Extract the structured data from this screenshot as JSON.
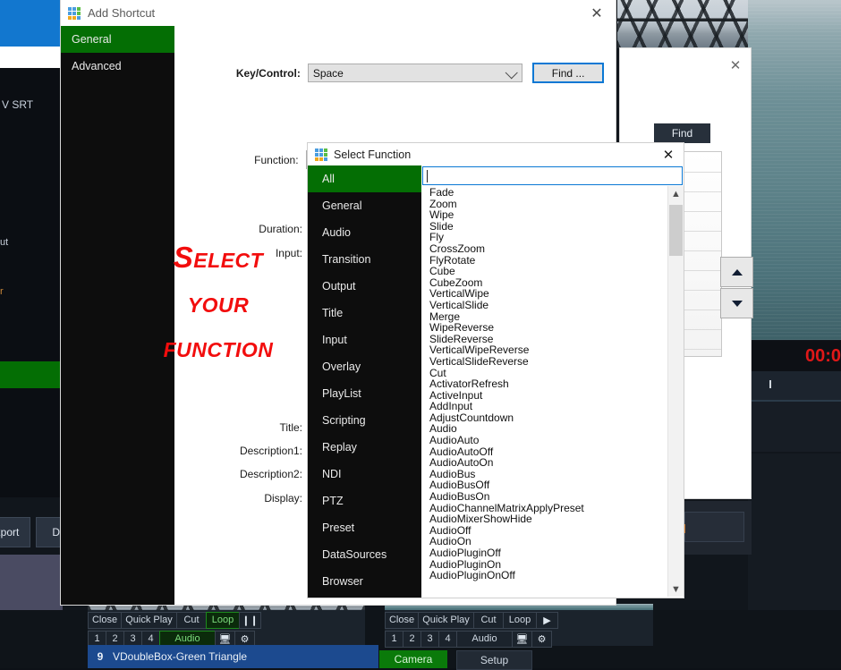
{
  "background": {
    "srt_label": "V SRT",
    "out_label": "ut",
    "r_label": "r",
    "export_button": "xport",
    "de_button": "De",
    "timer": "00:0",
    "left_deck": {
      "buttons_row1": [
        "Close",
        "Quick Play",
        "Cut",
        "Loop"
      ],
      "pause_icon": "pause-icon",
      "buttons_row2": [
        "1",
        "2",
        "3",
        "4",
        "Audio"
      ],
      "monitor_icon": "monitor-icon",
      "gear_icon": "gear-icon",
      "active_row1": "Loop",
      "active_row2": "Audio"
    },
    "right_deck": {
      "buttons_row1": [
        "Close",
        "Quick Play",
        "Cut",
        "Loop"
      ],
      "play_icon": "play-icon",
      "buttons_row2": [
        "1",
        "2",
        "3",
        "4",
        "Audio"
      ],
      "monitor_icon": "monitor-icon",
      "gear_icon": "gear-icon"
    },
    "playlist_row": {
      "number": "9",
      "name": "VDoubleBox-Green Triangle"
    },
    "camera_button": "Camera",
    "setup_button": "Setup"
  },
  "find_dialog": {
    "close_icon": "close-icon",
    "find_button": "Find",
    "spin_up_icon": "triangle-up-icon",
    "spin_down_icon": "triangle-down-icon"
  },
  "add_shortcut": {
    "title": "Add Shortcut",
    "app_icon": "windows-grid-icon",
    "close_icon": "close-icon",
    "sidebar": [
      {
        "label": "General",
        "active": true
      },
      {
        "label": "Advanced",
        "active": false
      }
    ],
    "fields": {
      "key_control_label": "Key/Control:",
      "key_control_value": "Space",
      "find_button": "Find ...",
      "function_label": "Function:",
      "function_value": "",
      "duration_label": "Duration:",
      "duration_value": "",
      "input_label": "Input:",
      "input_value": "",
      "title_label": "Title:",
      "title_value": "",
      "description1_label": "Description1:",
      "description1_value": "",
      "description2_label": "Description2:",
      "description2_value": "",
      "display_label": "Display:",
      "display_value": ""
    },
    "overlay_text": {
      "line1": "Select",
      "line2": "your",
      "line3": "function",
      "color": "#f20d0d"
    }
  },
  "select_function": {
    "title": "Select Function",
    "app_icon": "windows-grid-icon",
    "close_icon": "close-icon",
    "search_value": "",
    "search_placeholder": "",
    "categories": [
      {
        "label": "All",
        "active": true
      },
      {
        "label": "General",
        "active": false
      },
      {
        "label": "Audio",
        "active": false
      },
      {
        "label": "Transition",
        "active": false
      },
      {
        "label": "Output",
        "active": false
      },
      {
        "label": "Title",
        "active": false
      },
      {
        "label": "Input",
        "active": false
      },
      {
        "label": "Overlay",
        "active": false
      },
      {
        "label": "PlayList",
        "active": false
      },
      {
        "label": "Scripting",
        "active": false
      },
      {
        "label": "Replay",
        "active": false
      },
      {
        "label": "NDI",
        "active": false
      },
      {
        "label": "PTZ",
        "active": false
      },
      {
        "label": "Preset",
        "active": false
      },
      {
        "label": "DataSources",
        "active": false
      },
      {
        "label": "Browser",
        "active": false
      }
    ],
    "functions": [
      "Fade",
      "Zoom",
      "Wipe",
      "Slide",
      "Fly",
      "CrossZoom",
      "FlyRotate",
      "Cube",
      "CubeZoom",
      "VerticalWipe",
      "VerticalSlide",
      "Merge",
      "WipeReverse",
      "SlideReverse",
      "VerticalWipeReverse",
      "VerticalSlideReverse",
      "Cut",
      "ActivatorRefresh",
      "ActiveInput",
      "AddInput",
      "AdjustCountdown",
      "Audio",
      "AudioAuto",
      "AudioAutoOff",
      "AudioAutoOn",
      "AudioBus",
      "AudioBusOff",
      "AudioBusOn",
      "AudioChannelMatrixApplyPreset",
      "AudioMixerShowHide",
      "AudioOff",
      "AudioOn",
      "AudioPluginOff",
      "AudioPluginOn",
      "AudioPluginOnOff"
    ],
    "scroll_up_icon": "chevron-up-icon",
    "scroll_down_icon": "chevron-down-icon"
  },
  "colors": {
    "accent_green": "#046e04",
    "focus_blue": "#0a78d4",
    "overlay_red": "#f20d0d",
    "selection_blue": "#1c4a8f"
  }
}
